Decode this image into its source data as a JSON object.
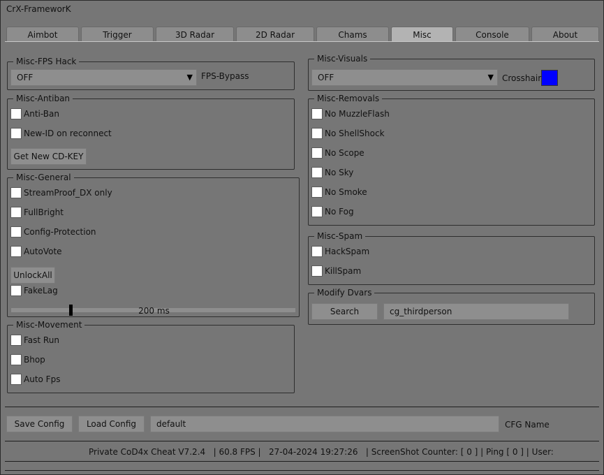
{
  "app": {
    "title": "CrX-FrameworK"
  },
  "tabs": [
    {
      "label": "Aimbot"
    },
    {
      "label": "Trigger"
    },
    {
      "label": "3D Radar"
    },
    {
      "label": "2D Radar"
    },
    {
      "label": "Chams"
    },
    {
      "label": "Misc",
      "active": true
    },
    {
      "label": "Console"
    },
    {
      "label": "About"
    }
  ],
  "fps_hack": {
    "title": "Misc-FPS Hack",
    "selected": "OFF",
    "label": "FPS-Bypass"
  },
  "antiban": {
    "title": "Misc-Antiban",
    "options": [
      {
        "label": "Anti-Ban",
        "checked": false
      },
      {
        "label": "New-ID on reconnect",
        "checked": false
      }
    ],
    "button": "Get New CD-KEY"
  },
  "general": {
    "title": "Misc-General",
    "options": [
      {
        "label": "StreamProof_DX only",
        "checked": false
      },
      {
        "label": "FullBright",
        "checked": false
      },
      {
        "label": "Config-Protection",
        "checked": false
      },
      {
        "label": "AutoVote",
        "checked": false
      }
    ],
    "unlock_button": "UnlockAll",
    "fakelag": {
      "label": "FakeLag",
      "checked": false
    },
    "slider": {
      "value_text": "200 ms",
      "fraction": 0.21
    }
  },
  "movement": {
    "title": "Misc-Movement",
    "options": [
      {
        "label": "Fast Run",
        "checked": false
      },
      {
        "label": "Bhop",
        "checked": false
      },
      {
        "label": "Auto Fps",
        "checked": false
      }
    ]
  },
  "visuals": {
    "title": "Misc-Visuals",
    "selected": "OFF",
    "crosshair_label": "Crosshair",
    "crosshair_color": "#0000ff"
  },
  "removals": {
    "title": "Misc-Removals",
    "options": [
      {
        "label": "No MuzzleFlash",
        "checked": false
      },
      {
        "label": "No ShellShock",
        "checked": false
      },
      {
        "label": "No Scope",
        "checked": false
      },
      {
        "label": "No Sky",
        "checked": false
      },
      {
        "label": "No Smoke",
        "checked": false
      },
      {
        "label": "No Fog",
        "checked": false
      }
    ]
  },
  "spam": {
    "title": "Misc-Spam",
    "options": [
      {
        "label": "HackSpam",
        "checked": false
      },
      {
        "label": "KillSpam",
        "checked": false
      }
    ]
  },
  "dvars": {
    "title": "Modify Dvars",
    "search_button": "Search",
    "input_value": "cg_thirdperson"
  },
  "config": {
    "save_button": "Save Config",
    "load_button": "Load Config",
    "name_value": "default",
    "name_label": "CFG Name"
  },
  "status": {
    "text": "Private CoD4x Cheat V7.2.4   | 60.8 FPS |   27-04-2024 19:27:26   | ScreenShot Counter: [ 0 ] | Ping [ 0 ] | User:"
  }
}
